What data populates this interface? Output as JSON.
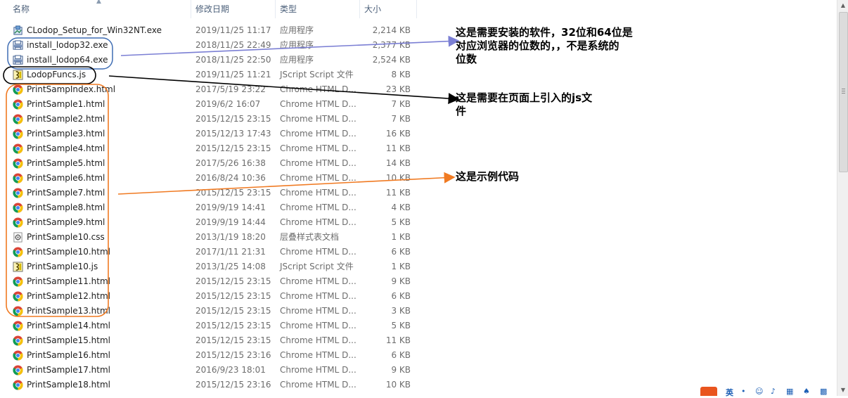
{
  "columns": {
    "name": "名称",
    "date": "修改日期",
    "type": "类型",
    "size": "大小"
  },
  "files": [
    {
      "name": "CLodop_Setup_for_Win32NT.exe",
      "date": "2019/11/25 11:17",
      "type": "应用程序",
      "size": "2,214 KB",
      "icon": "installer-icon"
    },
    {
      "name": "install_lodop32.exe",
      "date": "2018/11/25 22:49",
      "type": "应用程序",
      "size": "2,377 KB",
      "icon": "printer-exe-icon"
    },
    {
      "name": "install_lodop64.exe",
      "date": "2018/11/25 22:50",
      "type": "应用程序",
      "size": "2,524 KB",
      "icon": "printer-exe-icon"
    },
    {
      "name": "LodopFuncs.js",
      "date": "2019/11/25 11:21",
      "type": "JScript Script 文件",
      "size": "8 KB",
      "icon": "jscript-icon"
    },
    {
      "name": "PrintSampIndex.html",
      "date": "2017/5/19 23:22",
      "type": "Chrome HTML D...",
      "size": "23 KB",
      "icon": "chrome-icon"
    },
    {
      "name": "PrintSample1.html",
      "date": "2019/6/2 16:07",
      "type": "Chrome HTML D...",
      "size": "7 KB",
      "icon": "chrome-icon"
    },
    {
      "name": "PrintSample2.html",
      "date": "2015/12/15 23:15",
      "type": "Chrome HTML D...",
      "size": "7 KB",
      "icon": "chrome-icon"
    },
    {
      "name": "PrintSample3.html",
      "date": "2015/12/13 17:43",
      "type": "Chrome HTML D...",
      "size": "16 KB",
      "icon": "chrome-icon"
    },
    {
      "name": "PrintSample4.html",
      "date": "2015/12/15 23:15",
      "type": "Chrome HTML D...",
      "size": "11 KB",
      "icon": "chrome-icon"
    },
    {
      "name": "PrintSample5.html",
      "date": "2017/5/26 16:38",
      "type": "Chrome HTML D...",
      "size": "14 KB",
      "icon": "chrome-icon"
    },
    {
      "name": "PrintSample6.html",
      "date": "2016/8/24 10:36",
      "type": "Chrome HTML D...",
      "size": "10 KB",
      "icon": "chrome-icon"
    },
    {
      "name": "PrintSample7.html",
      "date": "2015/12/15 23:15",
      "type": "Chrome HTML D...",
      "size": "11 KB",
      "icon": "chrome-icon"
    },
    {
      "name": "PrintSample8.html",
      "date": "2019/9/19 14:41",
      "type": "Chrome HTML D...",
      "size": "4 KB",
      "icon": "chrome-icon"
    },
    {
      "name": "PrintSample9.html",
      "date": "2019/9/19 14:44",
      "type": "Chrome HTML D...",
      "size": "5 KB",
      "icon": "chrome-icon"
    },
    {
      "name": "PrintSample10.css",
      "date": "2013/1/19 18:20",
      "type": "层叠样式表文档",
      "size": "1 KB",
      "icon": "css-icon"
    },
    {
      "name": "PrintSample10.html",
      "date": "2017/1/11 21:31",
      "type": "Chrome HTML D...",
      "size": "6 KB",
      "icon": "chrome-icon"
    },
    {
      "name": "PrintSample10.js",
      "date": "2013/1/25 14:08",
      "type": "JScript Script 文件",
      "size": "1 KB",
      "icon": "jscript-icon"
    },
    {
      "name": "PrintSample11.html",
      "date": "2015/12/15 23:15",
      "type": "Chrome HTML D...",
      "size": "9 KB",
      "icon": "chrome-icon"
    },
    {
      "name": "PrintSample12.html",
      "date": "2015/12/15 23:15",
      "type": "Chrome HTML D...",
      "size": "6 KB",
      "icon": "chrome-icon"
    },
    {
      "name": "PrintSample13.html",
      "date": "2015/12/15 23:15",
      "type": "Chrome HTML D...",
      "size": "3 KB",
      "icon": "chrome-icon"
    },
    {
      "name": "PrintSample14.html",
      "date": "2015/12/15 23:15",
      "type": "Chrome HTML D...",
      "size": "5 KB",
      "icon": "chrome-icon"
    },
    {
      "name": "PrintSample15.html",
      "date": "2015/12/15 23:15",
      "type": "Chrome HTML D...",
      "size": "11 KB",
      "icon": "chrome-icon"
    },
    {
      "name": "PrintSample16.html",
      "date": "2015/12/15 23:16",
      "type": "Chrome HTML D...",
      "size": "6 KB",
      "icon": "chrome-icon"
    },
    {
      "name": "PrintSample17.html",
      "date": "2016/9/23 18:01",
      "type": "Chrome HTML D...",
      "size": "9 KB",
      "icon": "chrome-icon"
    },
    {
      "name": "PrintSample18.html",
      "date": "2015/12/15 23:16",
      "type": "Chrome HTML D...",
      "size": "10 KB",
      "icon": "chrome-icon"
    }
  ],
  "annotations": {
    "installers_line1": "这是需要安装的软件，32位和64位是",
    "installers_line2": "对应浏览器的位数的，，不是系统的",
    "installers_line3": "位数",
    "funcs_line1": "这是需要在页面上引入的js文",
    "funcs_line2": "件",
    "samples": "这是示例代码"
  },
  "tray": {
    "ime_label": "英"
  },
  "colors": {
    "blue_annotation": "#7b7fd4",
    "blue_outline": "#3f6db3",
    "black_annotation": "#000000",
    "orange_annotation": "#f07a22",
    "header_text": "#4c607a"
  }
}
